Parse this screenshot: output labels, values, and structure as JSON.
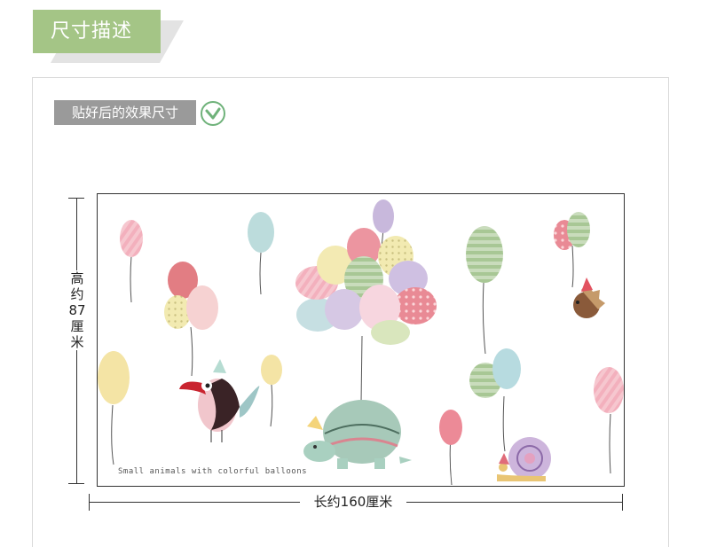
{
  "header": {
    "title": "尺寸描述"
  },
  "section": {
    "subtitle": "贴好后的效果尺寸"
  },
  "dimensions": {
    "height_label": "高约87厘米",
    "width_label": "长约160厘米"
  },
  "artwork": {
    "caption": "Small animals with colorful balloons"
  },
  "colors": {
    "accent_green": "#a4c586",
    "subtitle_gray": "#9a9a9a",
    "check_green": "#6fb27a"
  }
}
